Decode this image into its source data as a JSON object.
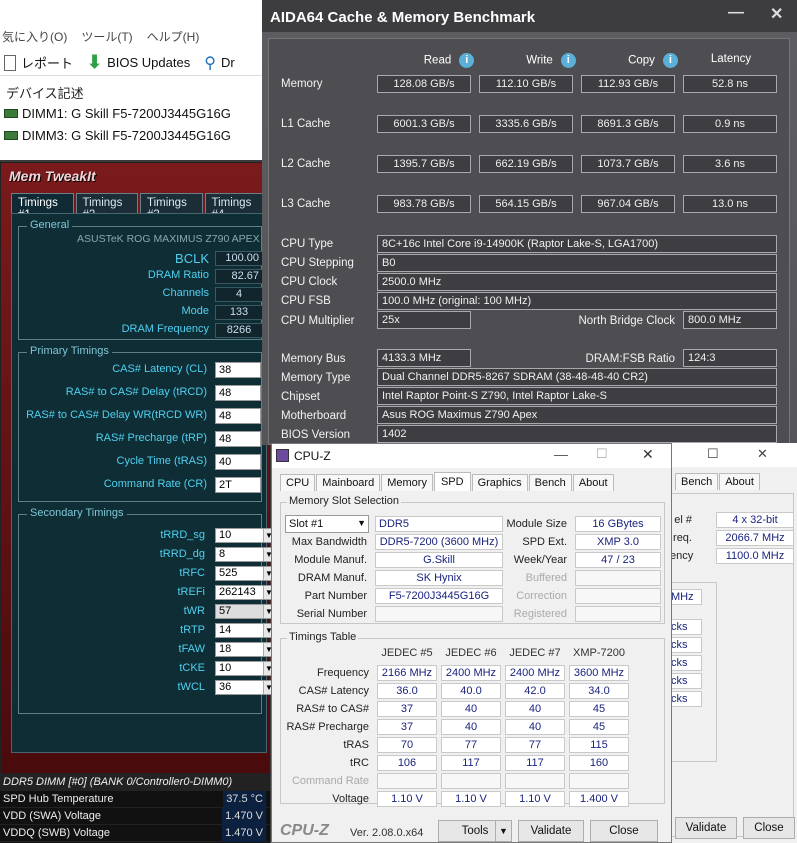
{
  "explorer": {
    "menu": [
      "気に入り(O)",
      "ツール(T)",
      "ヘルプ(H)"
    ],
    "report_label": "レポート",
    "bios_updates_label": "BIOS Updates",
    "dr_label": "Dr",
    "section_label": "デバイス記述",
    "dimms": [
      "DIMM1: G Skill F5-7200J3445G16G",
      "DIMM3: G Skill F5-7200J3445G16G"
    ]
  },
  "memtweakit": {
    "title": "Mem TweakIt",
    "tabs": [
      "Timings #1",
      "Timings #2",
      "Timings #3",
      "Timings #4"
    ],
    "general_title": "General",
    "board": "ASUSTeK ROG MAXIMUS Z790 APEX 1",
    "general": [
      {
        "label": "BCLK",
        "value": "100.00"
      },
      {
        "label": "DRAM Ratio",
        "value": "82.67"
      },
      {
        "label": "Channels",
        "value": "4"
      },
      {
        "label": "Mode",
        "value": "133"
      },
      {
        "label": "DRAM Frequency",
        "value": "8266"
      }
    ],
    "primary_title": "Primary Timings",
    "primary": [
      {
        "label": "CAS# Latency (CL)",
        "value": "38"
      },
      {
        "label": "RAS# to CAS# Delay (tRCD)",
        "value": "48"
      },
      {
        "label": "RAS# to CAS# Delay WR(tRCD WR)",
        "value": "48"
      },
      {
        "label": "RAS# Precharge (tRP)",
        "value": "48"
      },
      {
        "label": "Cycle Time (tRAS)",
        "value": "40"
      },
      {
        "label": "Command Rate (CR)",
        "value": "2T"
      }
    ],
    "secondary_title": "Secondary Timings",
    "secondary": [
      {
        "label": "tRRD_sg",
        "value": "10"
      },
      {
        "label": "tRRD_dg",
        "value": "8"
      },
      {
        "label": "tRFC",
        "value": "525"
      },
      {
        "label": "tREFi",
        "value": "262143"
      },
      {
        "label": "tWR",
        "value": "57"
      },
      {
        "label": "tRTP",
        "value": "14"
      },
      {
        "label": "tFAW",
        "value": "18"
      },
      {
        "label": "tCKE",
        "value": "10"
      },
      {
        "label": "tWCL",
        "value": "36"
      }
    ]
  },
  "sensor": {
    "header": "DDR5 DIMM [#0] (BANK 0/Controller0-DIMM0)",
    "rows": [
      {
        "label": "SPD Hub Temperature",
        "value": "37.5 °C"
      },
      {
        "label": "VDD (SWA) Voltage",
        "value": "1.470 V"
      },
      {
        "label": "VDDQ (SWB) Voltage",
        "value": "1.470 V"
      }
    ]
  },
  "aida": {
    "title": "AIDA64 Cache & Memory Benchmark",
    "columns": [
      "Read",
      "Write",
      "Copy",
      "Latency"
    ],
    "bench": [
      {
        "label": "Memory",
        "read": "128.08 GB/s",
        "write": "112.10 GB/s",
        "copy": "112.93 GB/s",
        "latency": "52.8 ns"
      },
      {
        "label": "L1 Cache",
        "read": "6001.3 GB/s",
        "write": "3335.6 GB/s",
        "copy": "8691.3 GB/s",
        "latency": "0.9 ns"
      },
      {
        "label": "L2 Cache",
        "read": "1395.7 GB/s",
        "write": "662.19 GB/s",
        "copy": "1073.7 GB/s",
        "latency": "3.6 ns"
      },
      {
        "label": "L3 Cache",
        "read": "983.78 GB/s",
        "write": "564.15 GB/s",
        "copy": "967.04 GB/s",
        "latency": "13.0 ns"
      }
    ],
    "cpu_type_label": "CPU Type",
    "cpu_type": "8C+16c Intel Core i9-14900K  (Raptor Lake-S, LGA1700)",
    "cpu_stepping_label": "CPU Stepping",
    "cpu_stepping": "B0",
    "cpu_clock_label": "CPU Clock",
    "cpu_clock": "2500.0 MHz",
    "cpu_fsb_label": "CPU FSB",
    "cpu_fsb": "100.0 MHz  (original: 100 MHz)",
    "cpu_mult_label": "CPU Multiplier",
    "cpu_mult": "25x",
    "nb_clock_label": "North Bridge Clock",
    "nb_clock": "800.0 MHz",
    "mem_bus_label": "Memory Bus",
    "mem_bus": "4133.3 MHz",
    "dram_fsb_label": "DRAM:FSB Ratio",
    "dram_fsb": "124:3",
    "mem_type_label": "Memory Type",
    "mem_type": "Dual Channel DDR5-8267 SDRAM  (38-48-48-40 CR2)",
    "chipset_label": "Chipset",
    "chipset": "Intel Raptor Point-S Z790, Intel Raptor Lake-S",
    "mobo_label": "Motherboard",
    "mobo": "Asus ROG Maximus Z790 Apex",
    "bios_label": "BIOS Version",
    "bios": "1402"
  },
  "cpuz": {
    "title": "CPU-Z",
    "tabs": [
      "CPU",
      "Mainboard",
      "Memory",
      "SPD",
      "Graphics",
      "Bench",
      "About"
    ],
    "slot_group": "Memory Slot Selection",
    "slot": "Slot #1",
    "ddr": "DDR5",
    "module_size_label": "Module Size",
    "module_size": "16 GBytes",
    "max_bw_label": "Max Bandwidth",
    "max_bw": "DDR5-7200 (3600 MHz)",
    "spd_ext_label": "SPD Ext.",
    "spd_ext": "XMP 3.0",
    "manuf_label": "Module Manuf.",
    "manuf": "G.Skill",
    "weekyear_label": "Week/Year",
    "weekyear": "47 / 23",
    "dram_manuf_label": "DRAM Manuf.",
    "dram_manuf": "SK Hynix",
    "buffered_label": "Buffered",
    "part_label": "Part Number",
    "part": "F5-7200J3445G16G",
    "correction_label": "Correction",
    "serial_label": "Serial Number",
    "registered_label": "Registered",
    "timings_group": "Timings Table",
    "timing_cols": [
      "JEDEC #5",
      "JEDEC #6",
      "JEDEC #7",
      "XMP-7200"
    ],
    "timing_rows": [
      {
        "label": "Frequency",
        "values": [
          "2166 MHz",
          "2400 MHz",
          "2400 MHz",
          "3600 MHz"
        ]
      },
      {
        "label": "CAS# Latency",
        "values": [
          "36.0",
          "40.0",
          "42.0",
          "34.0"
        ]
      },
      {
        "label": "RAS# to CAS#",
        "values": [
          "37",
          "40",
          "40",
          "45"
        ]
      },
      {
        "label": "RAS# Precharge",
        "values": [
          "37",
          "40",
          "40",
          "45"
        ]
      },
      {
        "label": "tRAS",
        "values": [
          "70",
          "77",
          "77",
          "115"
        ]
      },
      {
        "label": "tRC",
        "values": [
          "106",
          "117",
          "117",
          "160"
        ]
      },
      {
        "label": "Command Rate",
        "values": [
          "",
          "",
          "",
          ""
        ]
      },
      {
        "label": "Voltage",
        "values": [
          "1.10 V",
          "1.10 V",
          "1.10 V",
          "1.400 V"
        ]
      }
    ],
    "brand": "CPU-Z",
    "version": "Ver. 2.08.0.x64",
    "tools_label": "Tools",
    "validate_label": "Validate",
    "close_label": "Close"
  },
  "cpuz2": {
    "tabs": [
      "Bench",
      "About"
    ],
    "rows": [
      {
        "label": "el #",
        "value": "4 x 32-bit"
      },
      {
        "label": "req.",
        "value": "2066.7 MHz"
      },
      {
        "label": "ency",
        "value": "1100.0 MHz"
      }
    ],
    "cut_values": [
      "MHz",
      "cks",
      "cks",
      "cks",
      "cks",
      "cks"
    ],
    "validate_label": "Validate",
    "close_label": "Close"
  }
}
